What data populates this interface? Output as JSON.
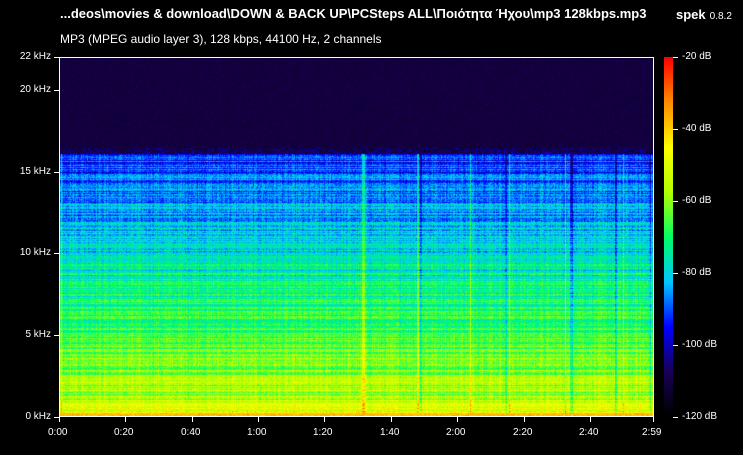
{
  "window": {
    "file_title": "...deos\\movies & download\\DOWN & BACK UP\\PCSteps ALL\\Ποιότητα Ήχου\\mp3 128kbps.mp3",
    "app_name": "spek",
    "app_version": "0.8.2"
  },
  "file_info": "MP3 (MPEG audio layer 3), 128 kbps, 44100 Hz, 2 channels",
  "spectrogram": {
    "frequency_axis": {
      "unit": "kHz",
      "max_khz": 22,
      "ticks": [
        {
          "value": 22,
          "label": "22 kHz"
        },
        {
          "value": 20,
          "label": "20 kHz"
        },
        {
          "value": 15,
          "label": "15 kHz"
        },
        {
          "value": 10,
          "label": "10 kHz"
        },
        {
          "value": 5,
          "label": "5 kHz"
        },
        {
          "value": 0,
          "label": "0 kHz"
        }
      ]
    },
    "time_axis": {
      "duration_seconds": 179,
      "ticks": [
        {
          "value": 0,
          "label": "0:00"
        },
        {
          "value": 20,
          "label": "0:20"
        },
        {
          "value": 40,
          "label": "0:40"
        },
        {
          "value": 60,
          "label": "1:00"
        },
        {
          "value": 80,
          "label": "1:20"
        },
        {
          "value": 100,
          "label": "1:40"
        },
        {
          "value": 120,
          "label": "2:00"
        },
        {
          "value": 140,
          "label": "2:20"
        },
        {
          "value": 160,
          "label": "2:40"
        },
        {
          "value": 179,
          "label": "2:59"
        }
      ]
    },
    "lowpass_cutoff_khz": 16,
    "level_scale": {
      "unit": "dB",
      "min_db": -120,
      "max_db": -20,
      "ticks": [
        {
          "value": -20,
          "label": "-20 dB"
        },
        {
          "value": -40,
          "label": "-40 dB"
        },
        {
          "value": -60,
          "label": "-60 dB"
        },
        {
          "value": -80,
          "label": "-80 dB"
        },
        {
          "value": -100,
          "label": "-100 dB"
        },
        {
          "value": -120,
          "label": "-120 dB"
        }
      ],
      "colors": [
        "#000000",
        "#1a0057",
        "#0000ff",
        "#00c8ff",
        "#00ff64",
        "#b4ff00",
        "#ffff00",
        "#ff8c00",
        "#ff0000"
      ]
    }
  }
}
